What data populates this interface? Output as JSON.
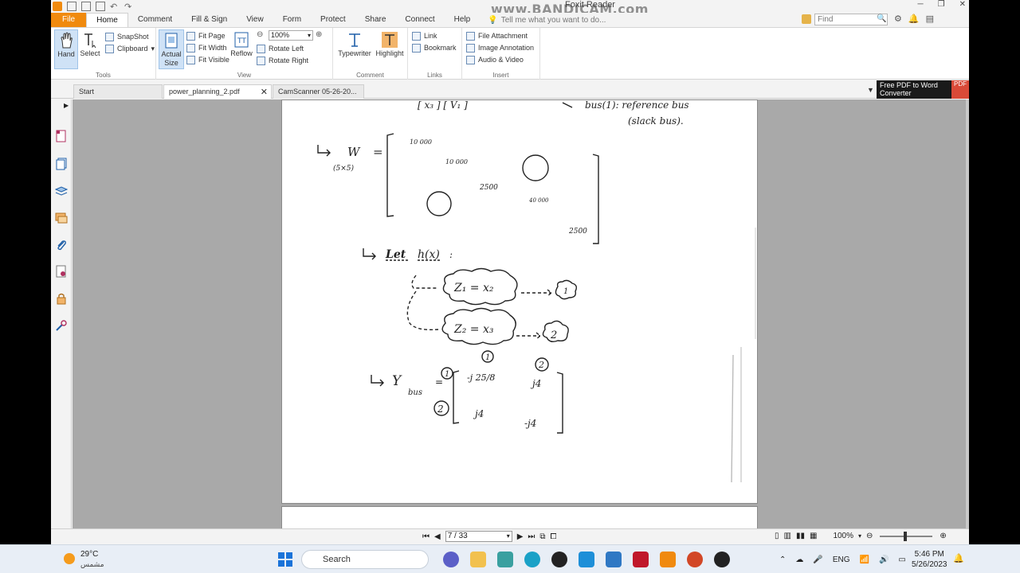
{
  "app": {
    "title": "Foxit Reader",
    "watermark": "www.BANDICAM.com"
  },
  "menu": {
    "items": [
      "File",
      "Home",
      "Comment",
      "Fill & Sign",
      "View",
      "Form",
      "Protect",
      "Share",
      "Connect",
      "Help"
    ],
    "tell_me": "Tell me what you want to do...",
    "find_placeholder": "Find"
  },
  "ribbon": {
    "tools": {
      "label": "Tools",
      "hand": "Hand",
      "select": "Select",
      "snapshot": "SnapShot",
      "clipboard": "Clipboard"
    },
    "view": {
      "label": "View",
      "actual_size": "Actual Size",
      "fit_page": "Fit Page",
      "fit_width": "Fit Width",
      "fit_visible": "Fit Visible",
      "reflow": "Reflow",
      "zoom": "100%",
      "rotate_left": "Rotate Left",
      "rotate_right": "Rotate Right"
    },
    "comment": {
      "label": "Comment",
      "typewriter": "Typewriter",
      "highlight": "Highlight"
    },
    "links": {
      "label": "Links",
      "link": "Link",
      "bookmark": "Bookmark"
    },
    "insert": {
      "label": "Insert",
      "file_attachment": "File Attachment",
      "image_annotation": "Image Annotation",
      "audio_video": "Audio & Video"
    }
  },
  "tabs": [
    "Start",
    "power_planning_2.pdf",
    "CamScanner 05-26-20..."
  ],
  "ad": {
    "text": "Free PDF to Word Converter",
    "badge": "PDF"
  },
  "status": {
    "page": "7 / 33",
    "zoom": "100%"
  },
  "taskbar": {
    "temp": "29°C",
    "weather_desc": "مشمس",
    "search": "Search",
    "lang": "ENG",
    "time": "5:46 PM",
    "date": "5/26/2023"
  },
  "handwritten": {
    "line_top_left": "[ x₃ ]   [ V₁ ]",
    "ref_bus": "bus(1): reference bus",
    "slack": "(slack bus).",
    "w_label": "W",
    "w_dim": "(5×5)",
    "w11": "10 000",
    "w22": "10 000",
    "w33": "2500",
    "w44": "40 000",
    "w55": "2500",
    "let": "Let",
    "hx": "h(x)",
    "z1": "Z₁ = x₂",
    "z2": "Z₂ = x₃",
    "n1": "1",
    "n2": "2",
    "ybus_y": "Y",
    "ybus_sub": "bus",
    "y11": "-j 25/8",
    "y12": "j4",
    "y21": "j4",
    "y22": "-j4"
  },
  "colors": {
    "accent": "#f08a0e",
    "selected": "#cfe2f6",
    "canvas": "#a9a9a9"
  }
}
